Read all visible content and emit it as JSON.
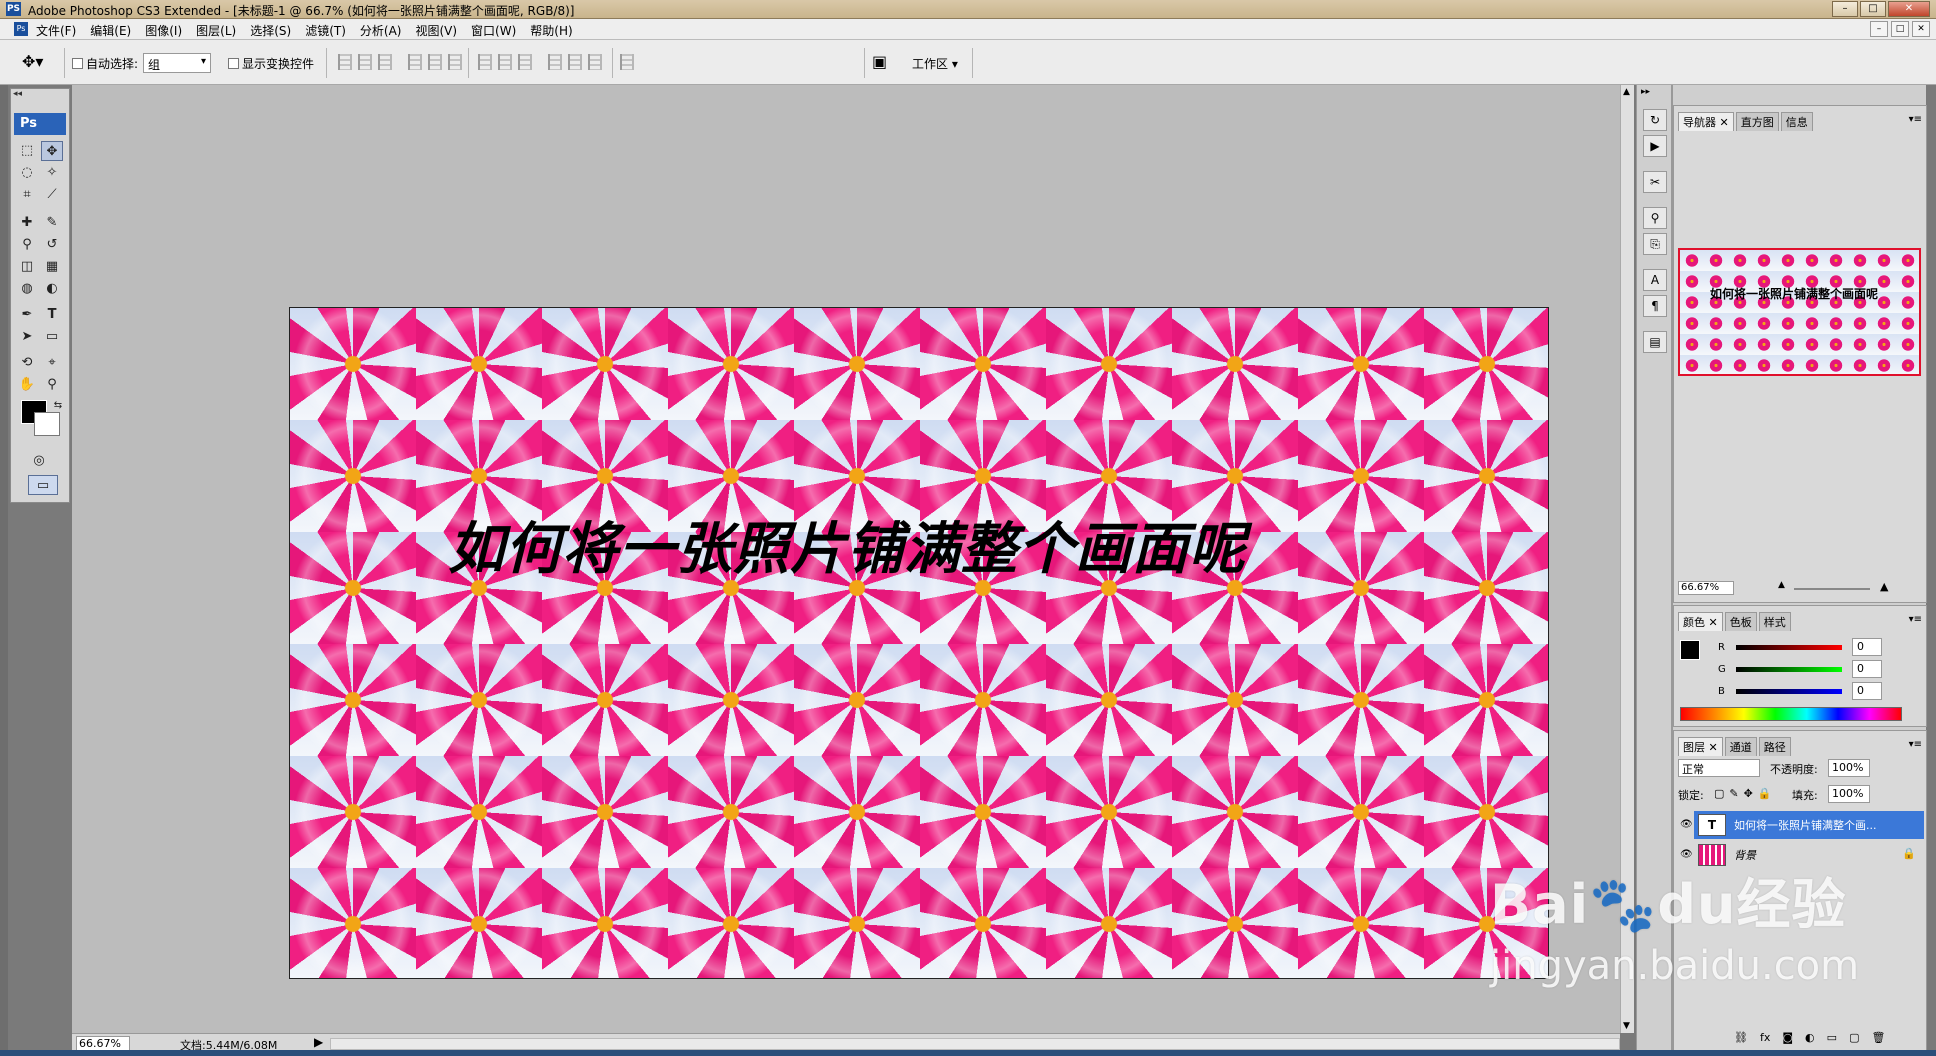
{
  "window": {
    "app_icon": "PS",
    "title": "Adobe Photoshop CS3 Extended - [未标题-1 @ 66.7% (如何将一张照片铺满整个画面呢, RGB/8)]",
    "buttons": [
      "–",
      "□",
      "✕"
    ]
  },
  "menubar": {
    "items": [
      "文件(F)",
      "编辑(E)",
      "图像(I)",
      "图层(L)",
      "选择(S)",
      "滤镜(T)",
      "分析(A)",
      "视图(V)",
      "窗口(W)",
      "帮助(H)"
    ],
    "doc_buttons": [
      "–",
      "□",
      "✕"
    ]
  },
  "options": {
    "auto_select_label": "自动选择:",
    "auto_select_value": "组",
    "show_transform_label": "显示变换控件",
    "workspace_label": "工作区 ▾"
  },
  "toolbox": {
    "header": "Ps",
    "collapse": "◂◂",
    "tools": [
      "marquee-icon",
      "move-icon",
      "lasso-icon",
      "magic-wand-icon",
      "crop-icon",
      "slice-icon",
      "healing-icon",
      "brush-icon",
      "stamp-icon",
      "history-brush-icon",
      "eraser-icon",
      "gradient-icon",
      "blur-icon",
      "dodge-icon",
      "pen-icon",
      "type-icon",
      "path-select-icon",
      "shape-icon",
      "3d-rotate-icon",
      "eyedropper-icon",
      "hand-icon",
      "zoom-icon"
    ],
    "glyphs": {
      "marquee": "⬚",
      "move": "✥",
      "lasso": "◌",
      "wand": "✧",
      "crop": "⌗",
      "slice": "⟋",
      "heal": "✚",
      "brush": "✎",
      "stamp": "⚲",
      "history": "↺",
      "eraser": "◫",
      "gradient": "▦",
      "blur": "◍",
      "dodge": "◐",
      "pen": "✒",
      "type": "T",
      "pathsel": "➤",
      "shape": "▭",
      "rotate3d": "⟲",
      "eyedrop": "⌖",
      "hand": "✋",
      "zoom": "⚲",
      "quickmask": "◎",
      "screen": "▭"
    }
  },
  "canvas": {
    "text_layer": "如何将一张照片铺满整个画面呢"
  },
  "status": {
    "zoom": "66.67%",
    "doc_size": "文档:5.44M/6.08M",
    "arrow": "▶"
  },
  "navigator": {
    "tabs": [
      "导航器 ✕",
      "直方图",
      "信息"
    ],
    "thumb_text": "如何将一张照片铺满整个画面呢",
    "zoom": "66.67%"
  },
  "color_panel": {
    "tabs": [
      "颜色 ✕",
      "色板",
      "样式"
    ],
    "channels": [
      {
        "label": "R",
        "value": "0",
        "color": "#cc0000"
      },
      {
        "label": "G",
        "value": "0",
        "color": "#00a000"
      },
      {
        "label": "B",
        "value": "0",
        "color": "#0000cc"
      }
    ]
  },
  "layers_panel": {
    "tabs": [
      "图层 ✕",
      "通道",
      "路径"
    ],
    "blend_mode": "正常",
    "opacity_label": "不透明度:",
    "opacity": "100%",
    "lock_label": "锁定:",
    "fill_label": "填充:",
    "fill": "100%",
    "layers": [
      {
        "name": "如何将一张照片铺满整个画...",
        "type": "T",
        "selected": true
      },
      {
        "name": "背景",
        "type": "image",
        "selected": false
      }
    ],
    "footer_icons": [
      "link-icon",
      "fx-icon",
      "mask-icon",
      "adjustment-icon",
      "group-icon",
      "new-layer-icon",
      "trash-icon"
    ]
  },
  "watermark": {
    "brand": "Bai🐾du经验",
    "url": "jingyan.baidu.com"
  },
  "colors": {
    "selection": "#3b78d8",
    "flower": "#e6177a",
    "flower_center": "#f2a516"
  }
}
